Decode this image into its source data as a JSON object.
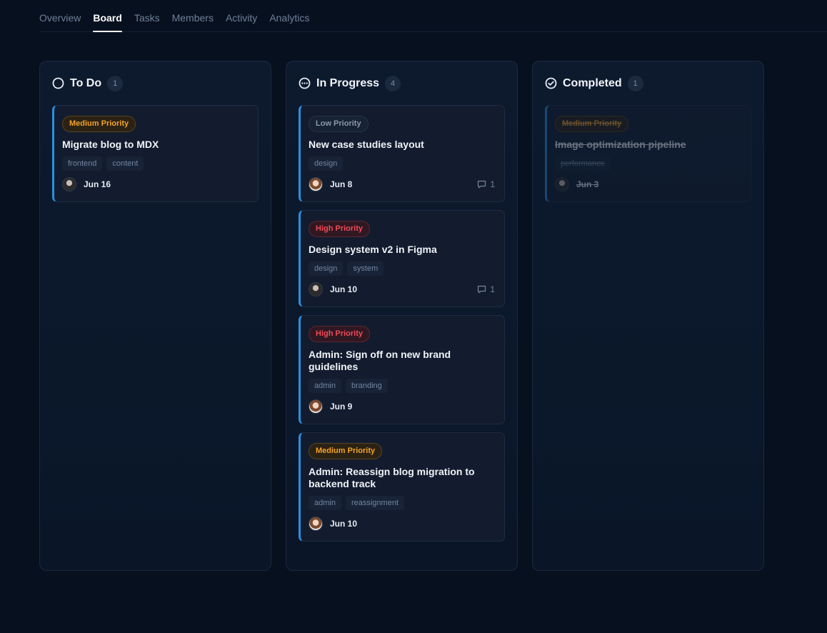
{
  "tabs": [
    {
      "label": "Overview"
    },
    {
      "label": "Board"
    },
    {
      "label": "Tasks"
    },
    {
      "label": "Members"
    },
    {
      "label": "Activity"
    },
    {
      "label": "Analytics"
    }
  ],
  "active_tab": "Board",
  "columns": [
    {
      "title": "To Do",
      "count": "1",
      "icon": "circle-icon",
      "cards": [
        {
          "priority": "Medium Priority",
          "title": "Migrate blog to MDX",
          "tags": [
            "frontend",
            "content"
          ],
          "due": "Jun 16",
          "avatar": "avatar",
          "comments": null
        }
      ]
    },
    {
      "title": "In Progress",
      "count": "4",
      "icon": "dots-circle-icon",
      "cards": [
        {
          "priority": "Low Priority",
          "title": "New case studies layout",
          "tags": [
            "design"
          ],
          "due": "Jun 8",
          "comments": "1"
        },
        {
          "priority": "High Priority",
          "title": "Design system v2 in Figma",
          "tags": [
            "design",
            "system"
          ],
          "due": "Jun 10",
          "comments": "1"
        },
        {
          "priority": "High Priority",
          "title": "Admin: Sign off on new brand guidelines",
          "tags": [
            "admin",
            "branding"
          ],
          "due": "Jun 9",
          "comments": null
        },
        {
          "priority": "Medium Priority",
          "title": "Admin: Reassign blog migration to backend track",
          "tags": [
            "admin",
            "reassignment"
          ],
          "due": "Jun 10",
          "comments": null
        }
      ]
    },
    {
      "title": "Completed",
      "count": "1",
      "icon": "check-circle-icon",
      "cards": [
        {
          "priority": "Medium Priority",
          "title": "Image optimization pipeline",
          "tags": [
            "performance"
          ],
          "due": "Jun 3",
          "comments": null
        }
      ]
    }
  ],
  "colors": {
    "background": "#07101f",
    "accent": "#2b8fe0",
    "medium": "#f3a229",
    "high": "#ef4a55",
    "low": "#8a98ae"
  }
}
